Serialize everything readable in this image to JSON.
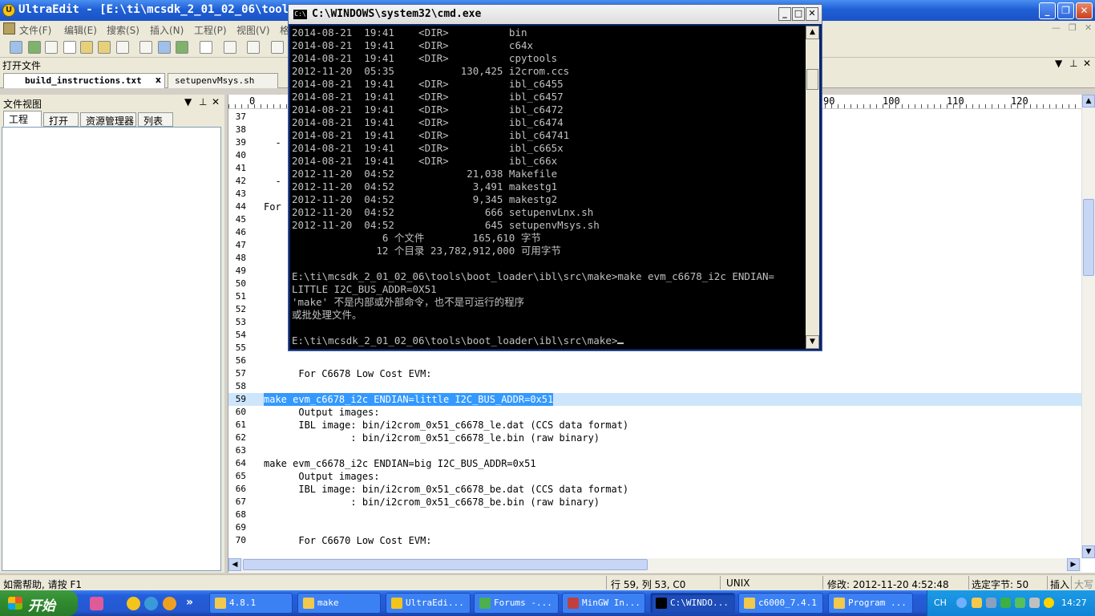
{
  "ue": {
    "title": "UltraEdit - [E:\\ti\\mcsdk_2_01_02_06\\tools\\",
    "menu": [
      {
        "label": "文件(F)"
      },
      {
        "label": "编辑(E)"
      },
      {
        "label": "搜索(S)"
      },
      {
        "label": "插入(N)"
      },
      {
        "label": "工程(P)"
      },
      {
        "label": "视图(V)"
      },
      {
        "label": "格"
      }
    ],
    "open_files_label": "打开文件",
    "tabs": [
      {
        "label": "build_instructions.txt",
        "close": "x"
      },
      {
        "label": "setupenvMsys.sh"
      }
    ],
    "fileview": {
      "title": "文件视图",
      "tabs": [
        {
          "label": "工程"
        },
        {
          "label": "打开"
        },
        {
          "label": "资源管理器"
        },
        {
          "label": "列表"
        }
      ]
    },
    "ruler": [
      {
        "label": "0"
      },
      {
        "label": "90"
      },
      {
        "label": "100"
      },
      {
        "label": "110"
      },
      {
        "label": "120"
      }
    ],
    "lines": [
      {
        "n": "37",
        "t": ""
      },
      {
        "n": "38",
        "t": ""
      },
      {
        "n": "39",
        "t": "  -"
      },
      {
        "n": "40",
        "t": ""
      },
      {
        "n": "41",
        "t": ""
      },
      {
        "n": "42",
        "t": "  -"
      },
      {
        "n": "43",
        "t": ""
      },
      {
        "n": "44",
        "t": "For"
      },
      {
        "n": "45",
        "t": ""
      },
      {
        "n": "46",
        "t": ""
      },
      {
        "n": "47",
        "t": ""
      },
      {
        "n": "48",
        "t": ""
      },
      {
        "n": "49",
        "t": ""
      },
      {
        "n": "50",
        "t": ""
      },
      {
        "n": "51",
        "t": ""
      },
      {
        "n": "52",
        "t": ""
      },
      {
        "n": "53",
        "t": ""
      },
      {
        "n": "54",
        "t": ""
      },
      {
        "n": "55",
        "t": ""
      },
      {
        "n": "56",
        "t": ""
      },
      {
        "n": "57",
        "t": "      For C6678 Low Cost EVM:"
      },
      {
        "n": "58",
        "t": ""
      },
      {
        "n": "59",
        "t": "make evm_c6678_i2c ENDIAN=little I2C_BUS_ADDR=0x51"
      },
      {
        "n": "60",
        "t": "      Output images:"
      },
      {
        "n": "61",
        "t": "      IBL image: bin/i2crom_0x51_c6678_le.dat (CCS data format)"
      },
      {
        "n": "62",
        "t": "               : bin/i2crom_0x51_c6678_le.bin (raw binary)"
      },
      {
        "n": "63",
        "t": ""
      },
      {
        "n": "64",
        "t": "make evm_c6678_i2c ENDIAN=big I2C_BUS_ADDR=0x51"
      },
      {
        "n": "65",
        "t": "      Output images:"
      },
      {
        "n": "66",
        "t": "      IBL image: bin/i2crom_0x51_c6678_be.dat (CCS data format)"
      },
      {
        "n": "67",
        "t": "               : bin/i2crom_0x51_c6678_be.bin (raw binary)"
      },
      {
        "n": "68",
        "t": ""
      },
      {
        "n": "69",
        "t": ""
      },
      {
        "n": "70",
        "t": "      For C6670 Low Cost EVM:"
      }
    ],
    "status": {
      "help": "如需帮助, 请按 F1",
      "position": "行 59, 列 53, C0",
      "format": "UNIX",
      "modified": "修改: 2012-11-20 4:52:48",
      "selected": "选定字节: 50",
      "mode": "插入",
      "caps": "大写"
    }
  },
  "cmd": {
    "title": "C:\\WINDOWS\\system32\\cmd.exe",
    "lines": [
      "2014-08-21  19:41    <DIR>          bin",
      "2014-08-21  19:41    <DIR>          c64x",
      "2014-08-21  19:41    <DIR>          cpytools",
      "2012-11-20  05:35           130,425 i2crom.ccs",
      "2014-08-21  19:41    <DIR>          ibl_c6455",
      "2014-08-21  19:41    <DIR>          ibl_c6457",
      "2014-08-21  19:41    <DIR>          ibl_c6472",
      "2014-08-21  19:41    <DIR>          ibl_c6474",
      "2014-08-21  19:41    <DIR>          ibl_c64741",
      "2014-08-21  19:41    <DIR>          ibl_c665x",
      "2014-08-21  19:41    <DIR>          ibl_c66x",
      "2012-11-20  04:52            21,038 Makefile",
      "2012-11-20  04:52             3,491 makestg1",
      "2012-11-20  04:52             9,345 makestg2",
      "2012-11-20  04:52               666 setupenvLnx.sh",
      "2012-11-20  04:52               645 setupenvMsys.sh",
      "               6 个文件        165,610 字节",
      "              12 个目录 23,782,912,000 可用字节",
      "",
      "E:\\ti\\mcsdk_2_01_02_06\\tools\\boot_loader\\ibl\\src\\make>make evm_c6678_i2c ENDIAN=",
      "LITTLE I2C_BUS_ADDR=0X51",
      "'make' 不是内部或外部命令，也不是可运行的程序",
      "或批处理文件。",
      "",
      "E:\\ti\\mcsdk_2_01_02_06\\tools\\boot_loader\\ibl\\src\\make>"
    ]
  },
  "taskbar": {
    "start": "开始",
    "overflow": "»",
    "tasks": [
      {
        "label": "4.8.1",
        "icon": "folder-icon",
        "color": "#f2c94c"
      },
      {
        "label": "make",
        "icon": "folder-icon",
        "color": "#f2c94c"
      },
      {
        "label": "UltraEdi...",
        "icon": "ultraedit-icon",
        "color": "#f3c41b"
      },
      {
        "label": "Forums -...",
        "icon": "chrome-icon",
        "color": "#4caf50"
      },
      {
        "label": "MinGW In...",
        "icon": "mingw-icon",
        "color": "#c04040"
      },
      {
        "label": "C:\\WINDO...",
        "icon": "cmd-icon",
        "color": "#000000"
      },
      {
        "label": "c6000_7.4.1",
        "icon": "folder-icon",
        "color": "#f2c94c"
      },
      {
        "label": "Program ...",
        "icon": "folder-icon",
        "color": "#f2c94c"
      }
    ],
    "tray": {
      "lang": "CH",
      "clock": "14:27"
    }
  }
}
